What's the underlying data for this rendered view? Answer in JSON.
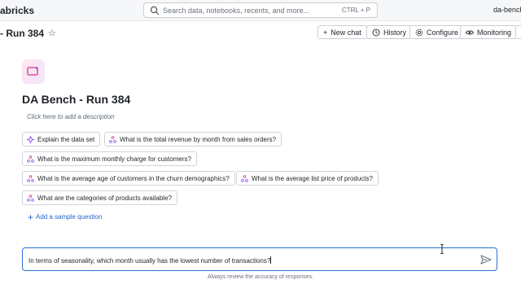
{
  "topbar": {
    "brand": "abricks",
    "search_placeholder": "Search data, notebooks, recents, and more...",
    "search_shortcut": "CTRL + P",
    "workspace": "da-bench"
  },
  "header": {
    "page_title": "- Run 384",
    "star_icon": "star-icon",
    "buttons": {
      "new_chat": "New chat",
      "history": "History",
      "configure": "Configure",
      "monitoring": "Monitoring"
    }
  },
  "space": {
    "icon": "sparkle-chat-icon",
    "title": "DA Bench - Run 384",
    "description_placeholder": "Click here to add a description"
  },
  "sample_questions": [
    "Explain the data set",
    "What is the total revenue by month from sales orders?",
    "What is the maximum monthly charge for customers?",
    "What is the average age of customers in the churn demographics?",
    "What is the average list price of products?",
    "What are the categories of products available?"
  ],
  "add_sample_label": "Add a sample question",
  "prompt": {
    "value": "In terms of seasonality, which month usually has the lowest number of transactions?"
  },
  "disclaimer": "Always review the accuracy of responses.",
  "colors": {
    "accent": "#2b6fd6",
    "link": "#2663cf",
    "icon_pink": "#d6337f",
    "icon_purple": "#8a3ffc"
  }
}
